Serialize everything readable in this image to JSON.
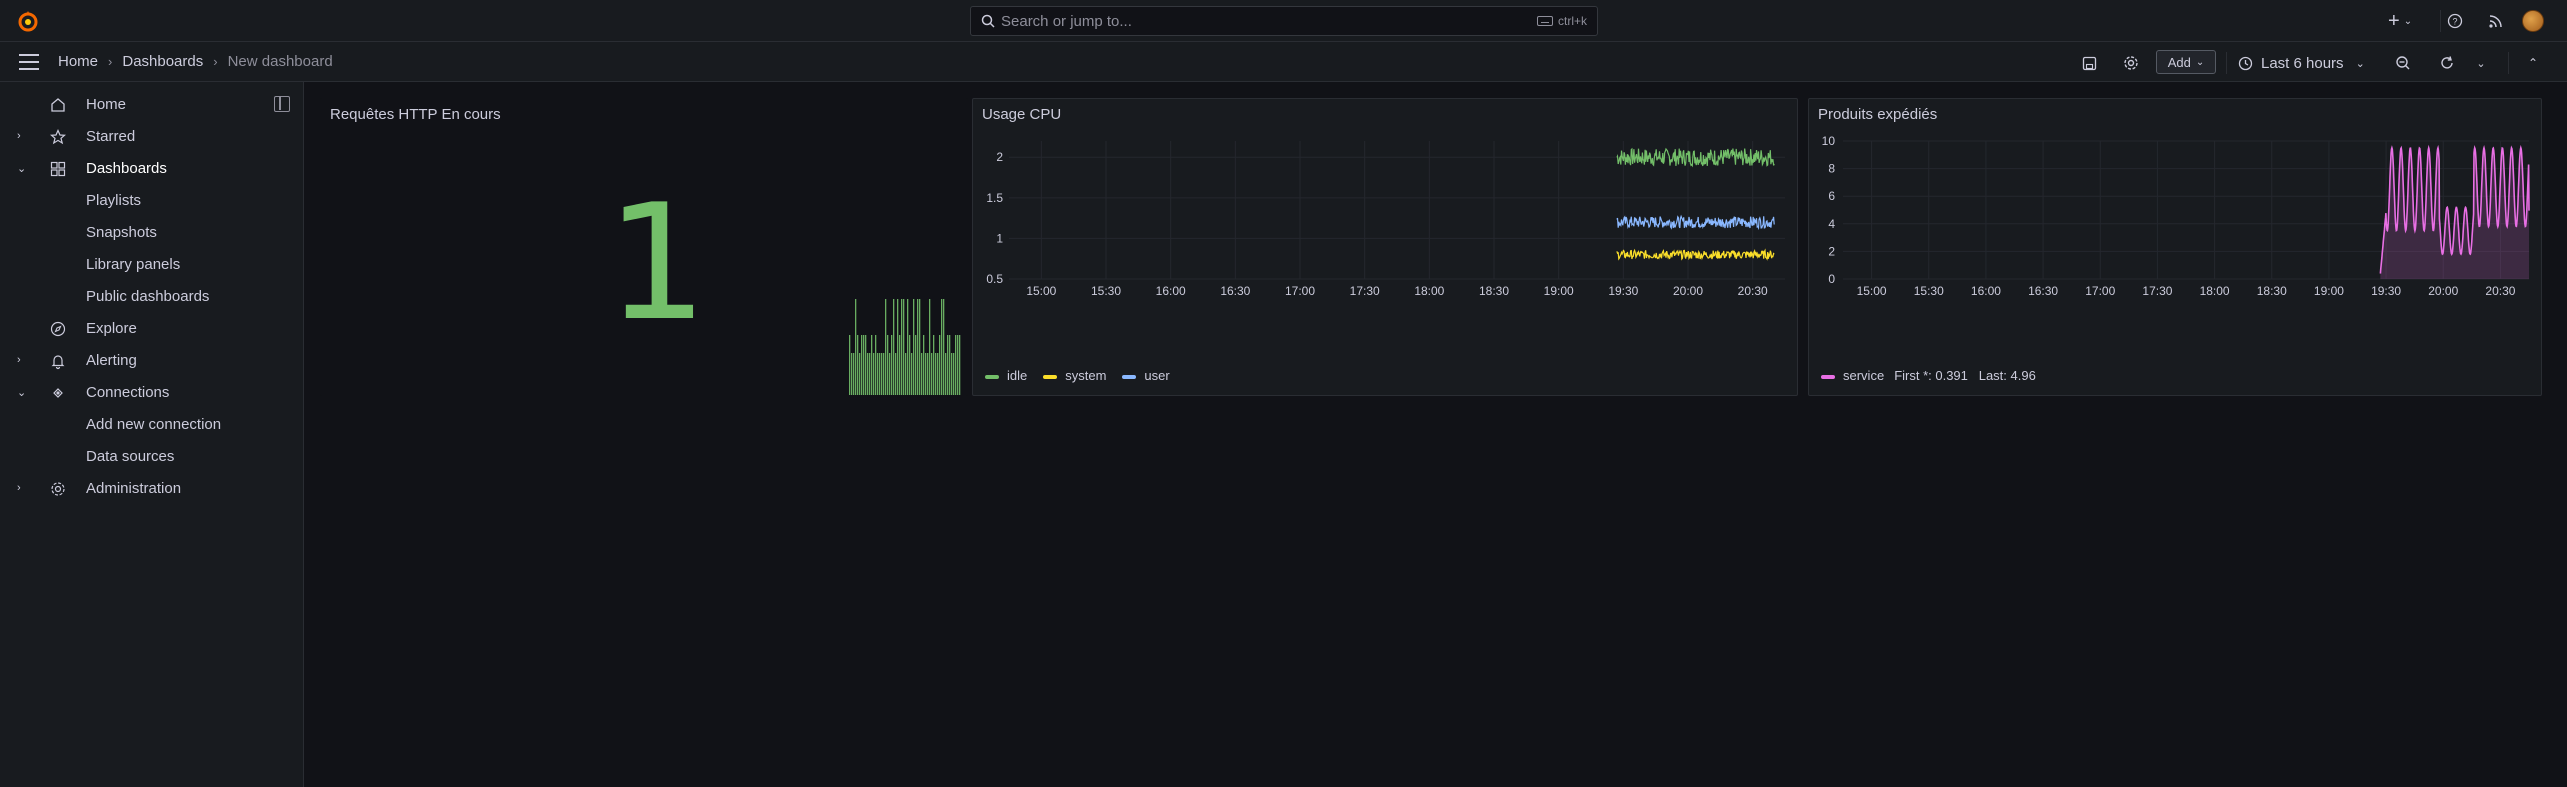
{
  "topbar": {
    "search_placeholder": "Search or jump to...",
    "search_shortcut": "ctrl+k",
    "plus_label": "+"
  },
  "breadcrumb": [
    "Home",
    "Dashboards",
    "New dashboard"
  ],
  "toolbar": {
    "add_label": "Add",
    "time_range": "Last 6 hours"
  },
  "sidebar": {
    "items": [
      {
        "label": "Home",
        "icon": "home-icon",
        "chev": ""
      },
      {
        "label": "Starred",
        "icon": "star-icon",
        "chev": "right"
      },
      {
        "label": "Dashboards",
        "icon": "dashboards-grid-icon",
        "chev": "down"
      },
      {
        "label": "Playlists",
        "icon": "",
        "chev": ""
      },
      {
        "label": "Snapshots",
        "icon": "",
        "chev": ""
      },
      {
        "label": "Library panels",
        "icon": "",
        "chev": ""
      },
      {
        "label": "Public dashboards",
        "icon": "",
        "chev": ""
      },
      {
        "label": "Explore",
        "icon": "compass-icon",
        "chev": ""
      },
      {
        "label": "Alerting",
        "icon": "bell-icon",
        "chev": "right"
      },
      {
        "label": "Connections",
        "icon": "connections-icon",
        "chev": "down"
      },
      {
        "label": "Add new connection",
        "icon": "",
        "chev": ""
      },
      {
        "label": "Data sources",
        "icon": "",
        "chev": ""
      },
      {
        "label": "Administration",
        "icon": "cog-icon",
        "chev": "right"
      }
    ]
  },
  "panels": {
    "stat": {
      "title": "Requêtes HTTP En cours",
      "value": "1",
      "color": "#73bf69"
    },
    "cpu": {
      "title": "Usage CPU",
      "legend": [
        {
          "name": "idle",
          "color": "#73bf69"
        },
        {
          "name": "system",
          "color": "#fade2a"
        },
        {
          "name": "user",
          "color": "#8ab8ff"
        }
      ]
    },
    "prod": {
      "title": "Produits expédiés",
      "legend_name": "service",
      "legend_stats": "First *: 0.391   Last: 4.96",
      "color": "#e86fe4"
    }
  },
  "chart_data": [
    {
      "type": "line",
      "title": "Usage CPU",
      "ylim": [
        0.5,
        2.2
      ],
      "yticks": [
        "2",
        "1.5",
        "1",
        "0.5"
      ],
      "xticks": [
        "15:00",
        "15:30",
        "16:00",
        "16:30",
        "17:00",
        "17:30",
        "18:00",
        "18:30",
        "19:00",
        "19:30",
        "20:00",
        "20:30"
      ],
      "series": [
        {
          "name": "idle",
          "x_range": [
            "19:27",
            "20:40"
          ],
          "level": 2.0,
          "noise": 0.06
        },
        {
          "name": "user",
          "x_range": [
            "19:27",
            "20:40"
          ],
          "level": 1.2,
          "noise": 0.04
        },
        {
          "name": "system",
          "x_range": [
            "19:27",
            "20:40"
          ],
          "level": 0.8,
          "noise": 0.03
        }
      ]
    },
    {
      "type": "area",
      "title": "Produits expédiés",
      "ylim": [
        0,
        10
      ],
      "yticks": [
        "10",
        "8",
        "6",
        "4",
        "2",
        "0"
      ],
      "xticks": [
        "15:00",
        "15:30",
        "16:00",
        "16:30",
        "17:00",
        "17:30",
        "18:00",
        "18:30",
        "19:00",
        "19:30",
        "20:00",
        "20:30"
      ],
      "series": [
        {
          "name": "service",
          "first": 0.391,
          "last": 4.96
        }
      ]
    }
  ]
}
